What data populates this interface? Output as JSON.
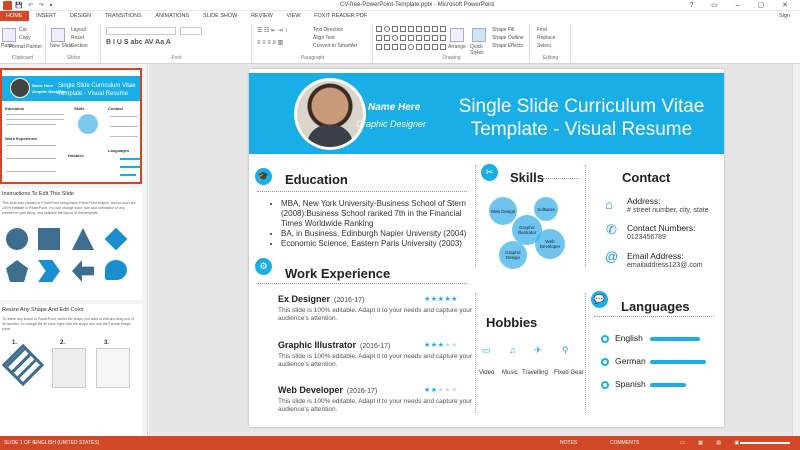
{
  "window": {
    "title": "CV-free-PowerPoint-Template.pptx - Microsoft PowerPoint"
  },
  "tabs": [
    "HOME",
    "INSERT",
    "DESIGN",
    "TRANSITIONS",
    "ANIMATIONS",
    "SLIDE SHOW",
    "REVIEW",
    "VIEW",
    "FOXIT READER PDF"
  ],
  "signin": "Sign",
  "ribbon": {
    "clipboard": {
      "label": "Clipboard",
      "paste": "Paste",
      "cut": "Cut",
      "copy": "Copy",
      "format_painter": "Format Painter"
    },
    "slides": {
      "label": "Slides",
      "new_slide": "New Slide",
      "layout": "Layout",
      "reset": "Reset",
      "section": "Section"
    },
    "font": {
      "label": "Font"
    },
    "paragraph": {
      "label": "Paragraph",
      "text_direction": "Text Direction",
      "align_text": "Align Text",
      "smartart": "Convert to SmartArt"
    },
    "drawing": {
      "label": "Drawing",
      "arrange": "Arrange",
      "quick_styles": "Quick Styles",
      "shape_fill": "Shape Fill",
      "shape_outline": "Shape Outline",
      "shape_effects": "Shape Effects"
    },
    "editing": {
      "label": "Editing",
      "find": "Find",
      "replace": "Replace",
      "select": "Select"
    }
  },
  "thumbnails": {
    "slide1": {
      "name": "Name Here",
      "role": "Graphic Designer",
      "title": "Single Slide Curriculum Vitae Template - Visual Resume",
      "sections": [
        "Education",
        "Skills",
        "Contact",
        "Work Experience",
        "Hobbies",
        "Languages"
      ]
    },
    "slide2": {
      "heading": "Instructions To Edit This Slide",
      "text": "This slide was created in PowerPoint using basic PowerPoint shapes, and as such are 100% editable in PowerPoint. You can change color, size and orientation of any element to your liking, and optimize the layout of this template."
    },
    "slide3": {
      "heading": "Resize Any Shape And Edit Color",
      "text": "To resize any shape in PowerPoint, select the shape you want to edit and drag one of its handles. To change the fill color, right-click the shape and use the Format Shape pane.",
      "steps": [
        "1.",
        "2.",
        "3."
      ]
    }
  },
  "slide": {
    "name": "Name Here",
    "role": "Graphic Designer",
    "title_line1": "Single Slide Curriculum Vitae",
    "title_line2": "Template - Visual Resume",
    "education": {
      "heading": "Education",
      "items": [
        "MBA, New York University-Business School of Stern (2008):Business School ranked 7th in the Financial Times Worldwide Ranking",
        "BA, in Business, Edinburgh Napier University (2004)",
        "Economic Science, Eastern Paris University (2003)"
      ]
    },
    "work": {
      "heading": "Work Experience",
      "jobs": [
        {
          "title": "Ex Designer",
          "years": "(2016-17)",
          "rating": 5,
          "desc": "This slide is 100% editable. Adapt it to your needs and capture your audience's attention."
        },
        {
          "title": "Graphic Illustrator",
          "years": "(2016-17)",
          "rating": 3,
          "desc": "This slide is 100% editable. Adapt it to your needs and capture your audience's attention."
        },
        {
          "title": "Web Developer",
          "years": "(2016-17)",
          "rating": 2,
          "desc": "This slide is 100% editable. Adapt it to your needs and capture your audience's attention."
        }
      ]
    },
    "skills": {
      "heading": "Skills",
      "bubbles": [
        "Web Design",
        "Software",
        "Graphic Illustrator",
        "Web Developer",
        "Graphic Design"
      ]
    },
    "hobbies": {
      "heading": "Hobbies",
      "items": [
        "Video",
        "Music",
        "Travelling",
        "Fixed Gear"
      ]
    },
    "contact": {
      "heading": "Contact",
      "address_label": "Address:",
      "address": "# street number, city, state",
      "phone_label": "Contact Numbers:",
      "phone": "0123456789",
      "email_label": "Email Address:",
      "email": "emailaddress123@.com"
    },
    "languages": {
      "heading": "Languages",
      "items": [
        {
          "name": "English",
          "level": 0.9
        },
        {
          "name": "German",
          "level": 1.0
        },
        {
          "name": "Spanish",
          "level": 0.65
        }
      ]
    }
  },
  "status": {
    "slide": "SLIDE 1 OF 6",
    "language": "ENGLISH (UNITED STATES)",
    "notes": "NOTES",
    "comments": "COMMENTS"
  },
  "colors": {
    "accent": "#1aaee6",
    "office": "#d24726"
  }
}
